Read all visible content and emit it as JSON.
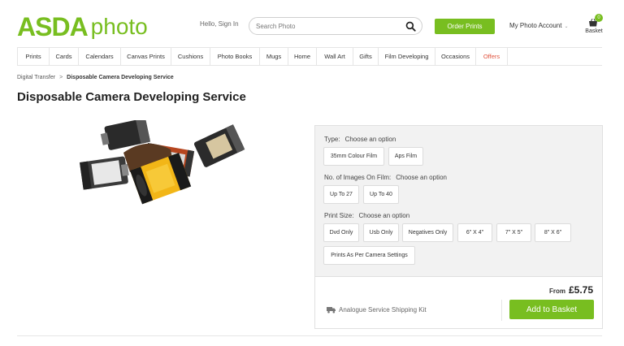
{
  "header": {
    "logo": {
      "brand": "ASDA",
      "product": "photo"
    },
    "hello_text": "Hello, Sign In",
    "search": {
      "placeholder": "Search Photo",
      "icon": "search-icon"
    },
    "order_prints_label": "Order Prints",
    "account_label": "My Photo Account",
    "basket": {
      "label": "Basket",
      "count": "0",
      "icon": "basket-icon"
    }
  },
  "nav": {
    "items": [
      "Prints",
      "Cards",
      "Calendars",
      "Canvas Prints",
      "Cushions",
      "Photo Books",
      "Mugs",
      "Home",
      "Wall Art",
      "Gifts",
      "Film Developing",
      "Occasions",
      "Offers"
    ]
  },
  "breadcrumb": {
    "parent": "Digital Transfer",
    "separator": ">",
    "current": "Disposable Camera Developing Service"
  },
  "page_title": "Disposable Camera Developing Service",
  "options": {
    "type": {
      "label": "Type:",
      "prompt": "Choose an option",
      "choices": [
        "35mm Colour Film",
        "Aps Film"
      ]
    },
    "images": {
      "label": "No. of Images On Film:",
      "prompt": "Choose an option",
      "choices": [
        "Up To 27",
        "Up To 40"
      ]
    },
    "print_size": {
      "label": "Print Size:",
      "prompt": "Choose an option",
      "choices": [
        "Dvd Only",
        "Usb Only",
        "Negatives Only",
        "6\" X 4\"",
        "7\" X 5\"",
        "8\" X 6\"",
        "Prints As Per Camera Settings"
      ]
    }
  },
  "pricing": {
    "from_label": "From",
    "price": "£5.75",
    "kit_label": "Analogue Service Shipping Kit",
    "add_to_basket_label": "Add to Basket"
  },
  "colors": {
    "brand_green": "#78be20",
    "offers_red": "#e0533e"
  }
}
